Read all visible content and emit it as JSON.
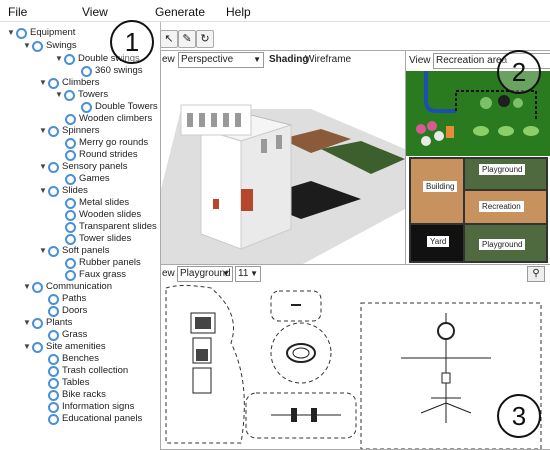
{
  "menu": {
    "file": "File",
    "view": "View",
    "generate": "Generate",
    "help": "Help"
  },
  "tree": [
    {
      "label": "Equipment"
    },
    {
      "label": "Swings"
    },
    {
      "label": "Double swings"
    },
    {
      "label": "360 swings"
    },
    {
      "label": "Climbers"
    },
    {
      "label": "Towers"
    },
    {
      "label": "Double Towers"
    },
    {
      "label": "Wooden climbers"
    },
    {
      "label": "Spinners"
    },
    {
      "label": "Merry go rounds"
    },
    {
      "label": "Round strides"
    },
    {
      "label": "Sensory panels"
    },
    {
      "label": "Games"
    },
    {
      "label": "Slides"
    },
    {
      "label": "Metal slides"
    },
    {
      "label": "Wooden slides"
    },
    {
      "label": "Transparent slides"
    },
    {
      "label": "Tower slides"
    },
    {
      "label": "Soft panels"
    },
    {
      "label": "Rubber panels"
    },
    {
      "label": "Faux grass"
    },
    {
      "label": "Communication"
    },
    {
      "label": "Paths"
    },
    {
      "label": "Doors"
    },
    {
      "label": "Plants"
    },
    {
      "label": "Grass"
    },
    {
      "label": "Site amenities"
    },
    {
      "label": "Benches"
    },
    {
      "label": "Trash collection"
    },
    {
      "label": "Tables"
    },
    {
      "label": "Bike racks"
    },
    {
      "label": "Information signs"
    },
    {
      "label": "Educational panels"
    }
  ],
  "view3d": {
    "view_label": "ew",
    "projection": "Perspective",
    "shading_label": "Shading",
    "shading_value": "Wireframe"
  },
  "viewpanel": {
    "view_label": "View",
    "area": "Recreation area"
  },
  "zones": {
    "building": "Building",
    "playground_top": "Playground",
    "recreation": "Recreation",
    "yard": "Yard",
    "playground_bottom": "Playground"
  },
  "view2d": {
    "view_label": "ew",
    "selection": "Playground",
    "size": "11"
  },
  "callouts": {
    "one": "1",
    "two": "2",
    "three": "3"
  },
  "colors": {
    "accent": "#4a90d9",
    "grass": "#2e7d32",
    "wood": "#a0522d",
    "dark": "#111111"
  }
}
